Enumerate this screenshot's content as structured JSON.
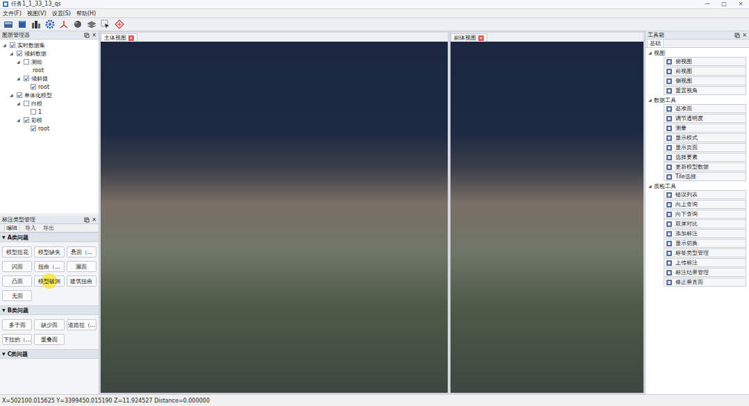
{
  "window": {
    "title": "任务1_1_33_13_qs",
    "controls": [
      "—",
      "□",
      "×"
    ]
  },
  "menu": [
    "文件(F)",
    "视图(V)",
    "设置(S)",
    "帮助(H)"
  ],
  "layers": {
    "title": "图层管理器",
    "close": "×",
    "tree": [
      {
        "label": "实时数据集",
        "arrow": "◢",
        "expanded": true,
        "kind": "checkbox",
        "checked": true,
        "children": [
          {
            "label": "倾斜数据",
            "arrow": "◢",
            "expanded": true,
            "kind": "checkbox",
            "checked": true,
            "children": [
              {
                "label": "测绘",
                "arrow": "◢",
                "expanded": true,
                "kind": "checkbox",
                "checked": false,
                "children": [
                  {
                    "label": "root",
                    "kind": "plain",
                    "children": []
                  }
                ]
              },
              {
                "label": "倾斜摄",
                "arrow": "◢",
                "expanded": true,
                "kind": "checkbox",
                "checked": true,
                "children": [
                  {
                    "label": "root",
                    "kind": "checkbox",
                    "checked": true,
                    "children": []
                  }
                ]
              }
            ]
          },
          {
            "label": "单体化模型",
            "arrow": "◢",
            "expanded": true,
            "kind": "checkbox",
            "checked": true,
            "children": [
              {
                "label": "白模",
                "arrow": "◢",
                "expanded": true,
                "kind": "checkbox",
                "checked": false,
                "children": [
                  {
                    "label": "1",
                    "kind": "checkbox",
                    "checked": false,
                    "children": []
                  }
                ]
              },
              {
                "label": "彩模",
                "arrow": "◢",
                "expanded": true,
                "kind": "checkbox",
                "checked": true,
                "children": [
                  {
                    "label": "root",
                    "kind": "checkbox",
                    "checked": true,
                    "children": []
                  }
                ]
              }
            ]
          }
        ]
      }
    ]
  },
  "annotation": {
    "title": "标注类型管理",
    "close": "×",
    "tabs": [
      {
        "label": "编辑",
        "selected": true
      },
      {
        "label": "导入",
        "selected": false
      },
      {
        "label": "导出",
        "selected": false
      }
    ],
    "sections": [
      {
        "arrow": "▼",
        "title": "A类问题",
        "expanded": true,
        "buttons": [
          {
            "label": "模型拉花",
            "hovered": false
          },
          {
            "label": "模型缺失",
            "hovered": false
          },
          {
            "label": "悬面（...",
            "hovered": false
          },
          {
            "label": "闪面",
            "hovered": false
          },
          {
            "label": "扭曲（...",
            "hovered": false
          },
          {
            "label": "漏面",
            "hovered": false
          },
          {
            "label": "凸面",
            "hovered": false
          },
          {
            "label": "模型破洞",
            "hovered": true
          },
          {
            "label": "建筑扭曲",
            "hovered": false
          },
          {
            "label": "无面",
            "hovered": false
          }
        ]
      },
      {
        "arrow": "▼",
        "title": "B类问题",
        "expanded": true,
        "buttons": [
          {
            "label": "多于面",
            "hovered": false
          },
          {
            "label": "缺少面",
            "hovered": false
          },
          {
            "label": "道路拉（...",
            "hovered": false
          },
          {
            "label": "下拉的（...",
            "hovered": false
          },
          {
            "label": "重叠面",
            "hovered": false
          }
        ]
      },
      {
        "arrow": "▼",
        "title": "C类问题",
        "expanded": true,
        "buttons": []
      }
    ]
  },
  "views": [
    {
      "title": "主体视图",
      "close": "×",
      "selected": true
    },
    {
      "title": "副体视图",
      "close": "×",
      "selected": false
    }
  ],
  "toolbox": {
    "title": "工具箱",
    "close": "×",
    "tabs": [
      {
        "label": "基础",
        "selected": true
      }
    ],
    "sections": [
      {
        "arrow": "◢",
        "title": "视图",
        "expanded": true,
        "items": [
          "俯视图",
          "前视图",
          "侧视图",
          "重置视角"
        ]
      },
      {
        "arrow": "◢",
        "title": "数据工具",
        "expanded": true,
        "items": [
          "基准面",
          "调节透明度",
          "测量",
          "显示模式",
          "显示页面",
          "选择要素",
          "更新模型数据",
          "Tile选择"
        ]
      },
      {
        "arrow": "◢",
        "title": "质检工具",
        "expanded": true,
        "items": [
          "错误列表",
          "向上查询",
          "向下查询",
          "双屏对比",
          "添加标注",
          "显示切换",
          "标签类型管理",
          "上传标注",
          "标注结果管理",
          "修正垂直面"
        ]
      }
    ]
  },
  "status_bar": "X=502100.015625 Y=3399450.015190 Z=11.924527 Distance=0.000000"
}
